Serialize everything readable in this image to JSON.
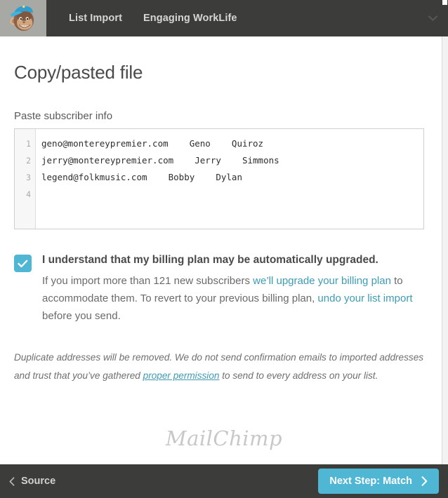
{
  "header": {
    "logo_icon": "mailchimp-freddie-monkey-icon",
    "nav": [
      {
        "label": "List Import"
      },
      {
        "label": "Engaging WorkLife"
      }
    ],
    "caret_icon": "chevron-down-icon"
  },
  "main": {
    "page_title": "Copy/pasted file",
    "field_label": "Paste subscriber info",
    "editor": {
      "line_numbers": [
        "1",
        "2",
        "3",
        "4"
      ],
      "lines": [
        "geno@montereypremier.com    Geno    Quiroz",
        "jerry@montereypremier.com    Jerry    Simmons",
        "legend@folkmusic.com    Bobby    Dylan",
        ""
      ]
    },
    "consent": {
      "checked": true,
      "check_icon": "checkmark-icon",
      "title": "I understand that my billing plan may be automatically upgraded.",
      "body_part1": "If you import more than 121 new subscribers ",
      "link1": "we’ll upgrade your billing plan",
      "body_part2": " to accommodate them. To revert to your previous billing plan, ",
      "link2": "undo your list import",
      "body_part3": " before you send."
    },
    "disclaimer": {
      "part1": "Duplicate addresses will be removed. We do not send confirmation emails to imported addresses and trust that you’ve gathered ",
      "link": "proper permission",
      "part2": " to send to every address on your list."
    },
    "wordmark": "MailChimp"
  },
  "footer": {
    "back_icon": "chevron-left-icon",
    "back_label": "Source",
    "next_label": "Next Step: Match",
    "next_icon": "chevron-right-icon"
  },
  "colors": {
    "accent_teal": "#4fb6d4",
    "link_teal": "#3d9bb4",
    "bar_dark": "#3c3c3a",
    "logo_panel": "#a8a8a4"
  }
}
